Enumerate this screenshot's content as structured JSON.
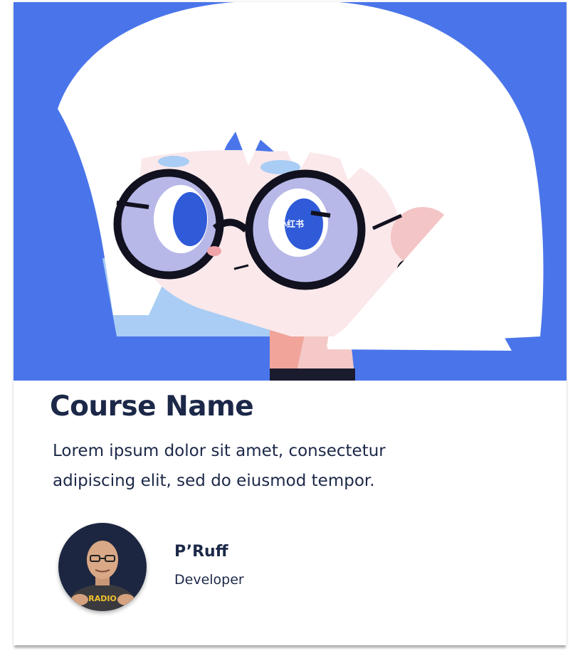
{
  "course": {
    "title": "Course Name",
    "description": "Lorem ipsum dolor sit amet, consectetur adipiscing elit, sed do eiusmod tempor."
  },
  "author": {
    "name": "P’Ruff",
    "role": "Developer",
    "avatar_shirt_text": "RADIO"
  },
  "illustration": {
    "subject": "cartoon girl with white bob hair and round black glasses",
    "watermark": "小红书"
  },
  "colors": {
    "hero_background": "#4a75ea",
    "text_primary": "#1c2848",
    "card_background": "#ffffff"
  }
}
